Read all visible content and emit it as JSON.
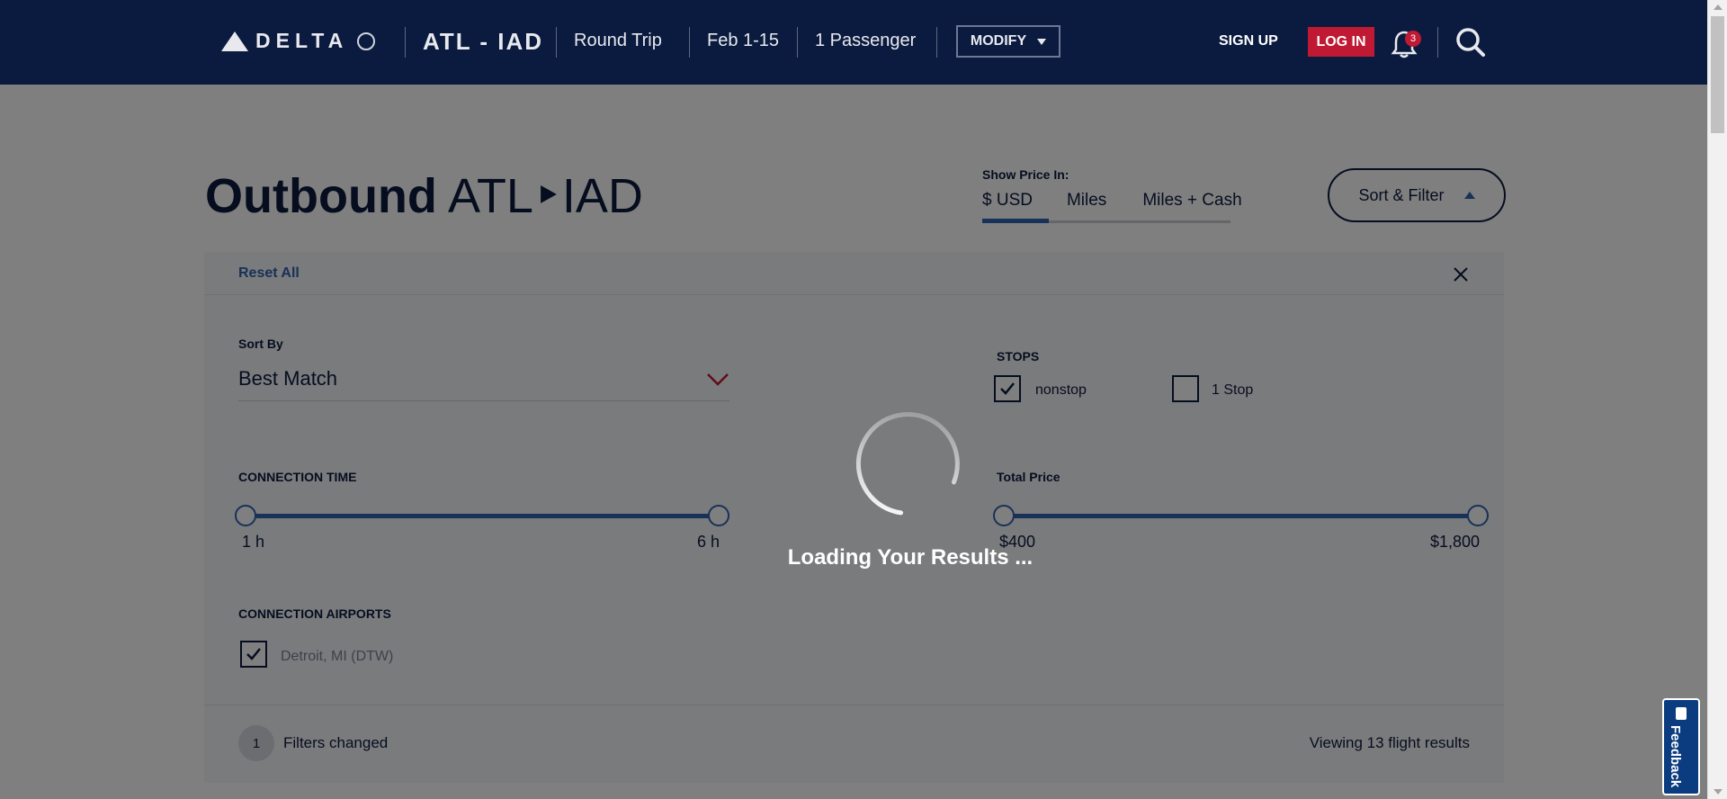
{
  "header": {
    "logo_text": "DELTA",
    "route": "ATL - IAD",
    "trip_type": "Round Trip",
    "dates": "Feb 1-15",
    "passengers": "1 Passenger",
    "modify_label": "MODIFY",
    "signup_label": "SIGN UP",
    "login_label": "LOG IN",
    "notification_count": "3",
    "login_color": "#c01933",
    "bg_color": "#0b1b3f"
  },
  "page": {
    "title_bold": "Outbound",
    "title_route": "ATL‣IAD"
  },
  "price": {
    "label": "Show Price In:",
    "tabs": [
      "$ USD",
      "Miles",
      "Miles + Cash"
    ],
    "selected": "$ USD"
  },
  "sort_filter": {
    "label": "Sort & Filter"
  },
  "filters": {
    "reset_label": "Reset All",
    "sort_by_label": "Sort By",
    "sort_by_value": "Best Match",
    "stops_label": "STOPS",
    "stops": [
      {
        "label": "nonstop",
        "checked": true
      },
      {
        "label": "1 Stop",
        "checked": false
      }
    ],
    "connection_time_label": "CONNECTION TIME",
    "connection_time_min": "1 h",
    "connection_time_max": "6 h",
    "total_price_label": "Total Price",
    "total_price_min": "$400",
    "total_price_max": "$1,800",
    "connection_airports_label": "CONNECTION AIRPORTS",
    "airports": [
      {
        "label": "Detroit, MI (DTW)",
        "checked": true
      }
    ],
    "changed_count": "1",
    "changed_label": "Filters changed",
    "viewing_label": "Viewing 13 flight results"
  },
  "feedback": {
    "label": "Feedback"
  },
  "loading": {
    "text": "Loading Your Results ..."
  },
  "icons": {
    "bell": "bell-icon",
    "search": "search-icon",
    "close": "close-icon",
    "chevron": "chevron-down-icon",
    "check": "checkmark-icon",
    "spinner": "loading-spinner-icon"
  }
}
